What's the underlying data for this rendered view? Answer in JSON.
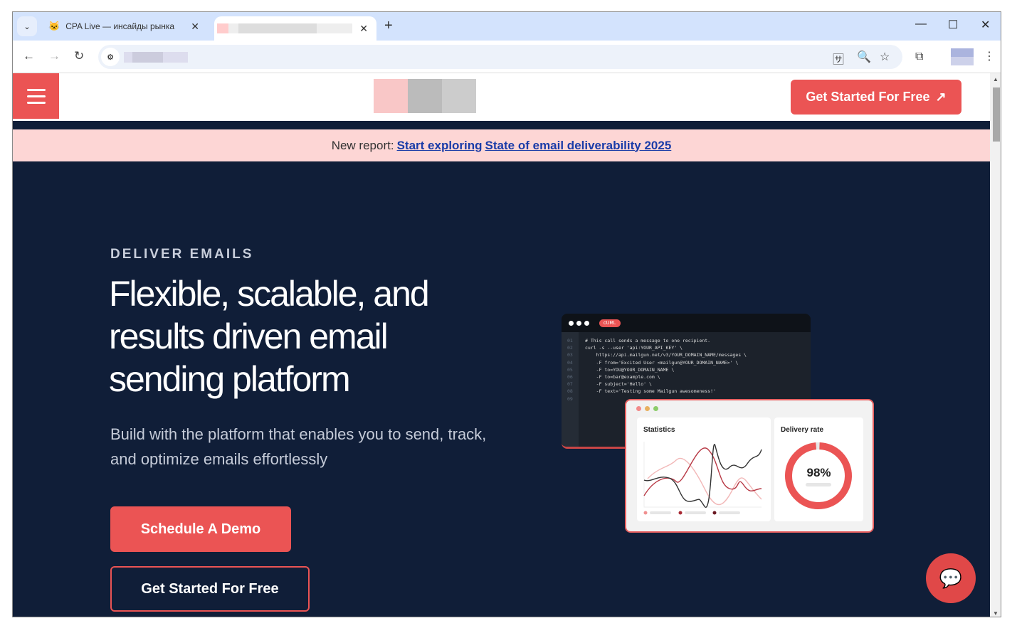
{
  "browser": {
    "tabs": [
      {
        "title": "CPA Live — инсайды рынка",
        "active": false
      },
      {
        "title": "",
        "active": true
      }
    ],
    "icons": {
      "tab_search": "chevron-down-icon",
      "back": "arrow-left-icon",
      "forward": "arrow-right-icon",
      "reload": "reload-icon",
      "site_info": "tune-icon",
      "translate": "translate-icon",
      "zoom": "zoom-icon",
      "bookmark": "star-icon",
      "extensions": "puzzle-icon",
      "menu": "kebab-icon"
    }
  },
  "header": {
    "cta_label": "Get Started For Free",
    "cta_icon": "external-link-icon",
    "menu_icon": "hamburger-icon"
  },
  "banner": {
    "prefix": "New report:",
    "link1": "Start exploring",
    "link2": "State of email deliverability 2025"
  },
  "hero": {
    "eyebrow": "DELIVER EMAILS",
    "title": "Flexible, scalable, and results driven email sending platform",
    "subtitle": "Build with the platform that enables you to send, track, and optimize emails effortlessly",
    "primary_button": "Schedule A Demo",
    "secondary_button": "Get Started For Free"
  },
  "illustration": {
    "code_badge": "cURL",
    "line_numbers": "01\n02\n03\n04\n05\n06\n07\n08\n09",
    "code": "# This call sends a message to one recipient.\ncurl -s --user 'api:YOUR_API_KEY' \\\n    https://api.mailgun.net/v3/YOUR_DOMAIN_NAME/messages \\\n    -F from='Excited User <mailgun@YOUR_DOMAIN_NAME>' \\\n    -F to=YOU@YOUR_DOMAIN_NAME \\\n    -F to=bar@example.com \\\n    -F subject='Hello' \\\n    -F text='Testing some Mailgun awesomeness!'",
    "stats_title": "Statistics",
    "delivery_title": "Delivery rate",
    "delivery_rate": "98%",
    "delivery_value": 98
  },
  "colors": {
    "accent": "#eb5454",
    "background": "#101e38",
    "banner": "#fdd6d5"
  },
  "chat_icon": "chat-bubbles-icon"
}
